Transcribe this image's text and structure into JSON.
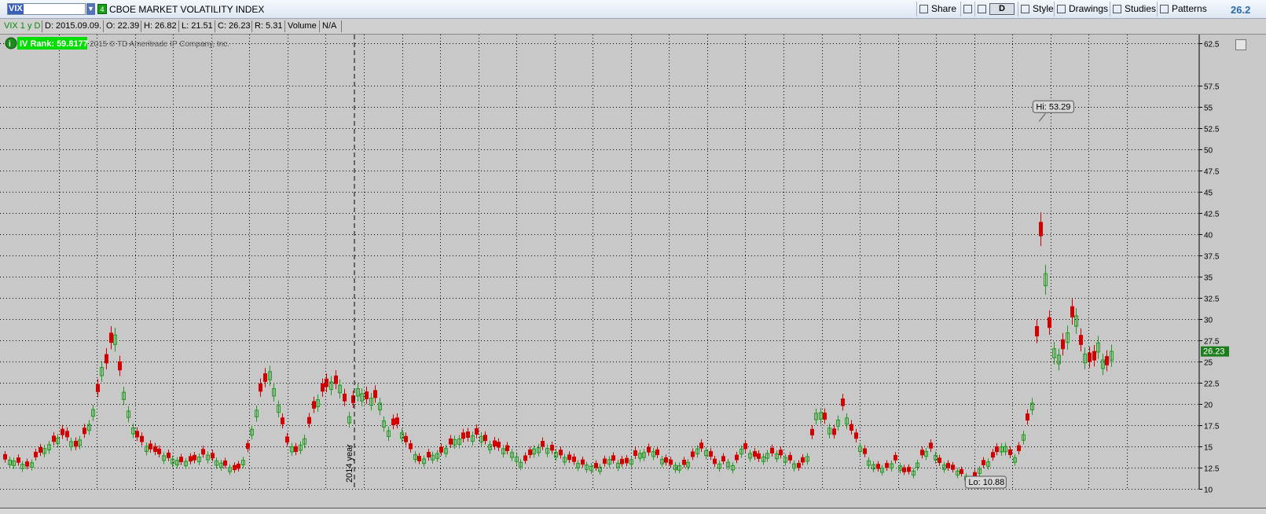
{
  "toolbar": {
    "symbol": "VIX",
    "badge": "4",
    "title": "CBOE MARKET VOLATILITY INDEX",
    "buttons": [
      "Share",
      "Style",
      "Drawings",
      "Studies",
      "Patterns"
    ],
    "aggregation_label": "D",
    "last_price": "26.2"
  },
  "info": {
    "period": "VIX 1 y D",
    "date": "D: 2015.09.09.",
    "open": "O: 22.39",
    "high": "H: 26.82",
    "low": "L: 21.51",
    "close": "C: 26.23",
    "range": "R: 5.31",
    "volume_label": "Volume",
    "volume_value": "N/A"
  },
  "chart_data": {
    "type": "candlestick",
    "title": "CBOE MARKET VOLATILITY INDEX",
    "period": "1 y D",
    "iv_rank_label": "IV Rank: 59.8177",
    "copyright": "2015 © TD Ameritrade IP Company, Inc.",
    "year_marker": "2014 year",
    "hi_label": "Hi: 53.29",
    "lo_label": "Lo: 10.88",
    "price_badge": "26.23",
    "ylim": [
      10,
      63.5
    ],
    "y_ticks": [
      10,
      12.5,
      15,
      17.5,
      20,
      22.5,
      25,
      27.5,
      30,
      32.5,
      35,
      37.5,
      40,
      42.5,
      45,
      47.5,
      50,
      52.5,
      55,
      57.5,
      62.5
    ],
    "y_tick_labels": [
      "10",
      "12.5",
      "15",
      "17.5",
      "20",
      "22.5",
      "25",
      "27.5",
      "30",
      "32.5",
      "35",
      "37.5",
      "40",
      "42.5",
      "45",
      "47.5",
      "50",
      "52.5",
      "55",
      "57.5",
      "62.5"
    ],
    "grid": true,
    "colors": {
      "up": "#1f9a1f",
      "down": "#d00000",
      "grid": "#000000",
      "background": "#c8c8c8",
      "badge": "#1c7d1c",
      "iv_rank": "#00dd00"
    },
    "up_down_pattern": "011010100110100101011010010111001000101101001010110100101100111001011001001010101101011100100101011010110010101001011100110101010010110101010010110101001101010100101101010011010101001011010101001011010101001101010100101101010011010101001011010101001101010100101101010011010101001011010101001101010100101101010011010101001011010101001101010100101101010011",
    "close_profile": [
      [
        0,
        13.5
      ],
      [
        8,
        13.2
      ],
      [
        16,
        12.6
      ],
      [
        22,
        14.0
      ],
      [
        30,
        15.2
      ],
      [
        40,
        16.5
      ],
      [
        48,
        15.0
      ],
      [
        56,
        17.0
      ],
      [
        62,
        20.5
      ],
      [
        66,
        24.3
      ],
      [
        70,
        25.0
      ],
      [
        74,
        29.5
      ],
      [
        78,
        24.0
      ],
      [
        82,
        20.5
      ],
      [
        88,
        16.5
      ],
      [
        96,
        15.0
      ],
      [
        104,
        14.2
      ],
      [
        112,
        13.6
      ],
      [
        120,
        13.2
      ],
      [
        128,
        13.3
      ],
      [
        136,
        14.2
      ],
      [
        144,
        13.3
      ],
      [
        152,
        12.6
      ],
      [
        158,
        12.1
      ],
      [
        164,
        14.0
      ],
      [
        170,
        18.5
      ],
      [
        174,
        21.5
      ],
      [
        180,
        23.8
      ],
      [
        186,
        19.8
      ],
      [
        192,
        15.5
      ],
      [
        198,
        14.4
      ],
      [
        204,
        15.9
      ],
      [
        210,
        19.5
      ],
      [
        216,
        21.5
      ],
      [
        222,
        22.6
      ],
      [
        228,
        22.2
      ],
      [
        234,
        18.5
      ],
      [
        240,
        21.8
      ],
      [
        246,
        20.6
      ],
      [
        254,
        20.8
      ],
      [
        260,
        16.6
      ],
      [
        266,
        18.0
      ],
      [
        274,
        15.2
      ],
      [
        282,
        13.3
      ],
      [
        290,
        13.9
      ],
      [
        298,
        14.4
      ],
      [
        306,
        15.8
      ],
      [
        314,
        16.0
      ],
      [
        322,
        16.5
      ],
      [
        330,
        15.2
      ],
      [
        338,
        14.8
      ],
      [
        346,
        14.2
      ],
      [
        352,
        12.9
      ],
      [
        360,
        14.7
      ],
      [
        366,
        15.0
      ],
      [
        374,
        14.4
      ],
      [
        382,
        13.6
      ],
      [
        390,
        13.0
      ],
      [
        396,
        12.8
      ],
      [
        404,
        12.4
      ],
      [
        412,
        13.6
      ],
      [
        418,
        12.9
      ],
      [
        424,
        13.1
      ],
      [
        430,
        14.1
      ],
      [
        436,
        14.3
      ],
      [
        442,
        14.4
      ],
      [
        448,
        13.3
      ],
      [
        454,
        12.8
      ],
      [
        460,
        12.7
      ],
      [
        466,
        13.2
      ],
      [
        472,
        15.0
      ],
      [
        478,
        14.4
      ],
      [
        484,
        12.7
      ],
      [
        490,
        13.4
      ],
      [
        496,
        12.6
      ],
      [
        502,
        15.1
      ],
      [
        508,
        14.0
      ],
      [
        514,
        13.5
      ],
      [
        520,
        14.3
      ],
      [
        528,
        14.0
      ],
      [
        534,
        13.4
      ],
      [
        540,
        12.5
      ],
      [
        546,
        13.8
      ],
      [
        552,
        18.9
      ],
      [
        556,
        19.0
      ],
      [
        560,
        17.4
      ],
      [
        564,
        16.4
      ],
      [
        570,
        19.8
      ],
      [
        576,
        16.9
      ],
      [
        582,
        15.0
      ],
      [
        588,
        13.3
      ],
      [
        594,
        12.4
      ],
      [
        600,
        12.5
      ],
      [
        606,
        13.4
      ],
      [
        612,
        12.0
      ],
      [
        618,
        12.1
      ],
      [
        624,
        14.0
      ],
      [
        630,
        14.8
      ],
      [
        636,
        13.1
      ],
      [
        642,
        12.5
      ],
      [
        648,
        12.1
      ],
      [
        654,
        11.5
      ],
      [
        658,
        10.9
      ],
      [
        664,
        12.6
      ],
      [
        670,
        13.3
      ],
      [
        676,
        14.6
      ],
      [
        680,
        15.3
      ],
      [
        686,
        13.4
      ],
      [
        690,
        14.5
      ],
      [
        694,
        17.0
      ],
      [
        698,
        19.2
      ],
      [
        700,
        21.0
      ],
      [
        702,
        28.0
      ],
      [
        704,
        40.7
      ],
      [
        707,
        38.0
      ],
      [
        710,
        30.0
      ],
      [
        713,
        27.0
      ],
      [
        716,
        25.5
      ],
      [
        720,
        26.5
      ],
      [
        724,
        29.0
      ],
      [
        728,
        31.5
      ],
      [
        732,
        27.0
      ],
      [
        736,
        25.5
      ],
      [
        740,
        24.5
      ],
      [
        744,
        27.2
      ],
      [
        748,
        24.5
      ],
      [
        750,
        24.6
      ],
      [
        753,
        26.2
      ]
    ],
    "x_count": 754
  }
}
